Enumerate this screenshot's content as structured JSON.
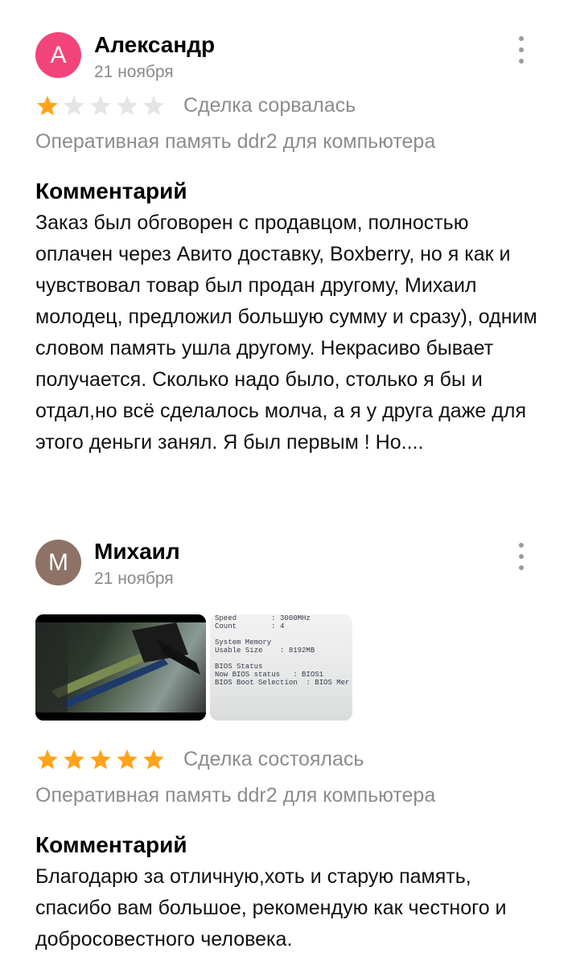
{
  "reviews": [
    {
      "avatar_letter": "А",
      "avatar_color": "#f2447b",
      "name": "Александр",
      "date": "21 ноября",
      "rating": 1,
      "deal_status": "Сделка сорвалась",
      "product": "Оперативная память ddr2 для компьютера",
      "comment_title": "Комментарий",
      "comment": "Заказ был обговорен с продавцом, полностью оплачен через Авито доставку, Boxberry, но я как и чувствовал товар был продан другому, Михаил молодец, предложил большую сумму и сразу), одним словом память ушла другому. Некрасиво бывает получается. Сколько надо было, столько я бы и отдал,но всё сделалось молча, а я у друга даже для этого деньги занял. Я был первым ! Но...."
    },
    {
      "avatar_letter": "М",
      "avatar_color": "#8e7266",
      "name": "Михаил",
      "date": "21 ноября",
      "rating": 5,
      "deal_status": "Сделка состоялась",
      "product": "Оперативная память ddr2 для компьютера",
      "comment_title": "Комментарий",
      "comment": "Благодарю за отличную,хоть и старую память, спасибо вам большое, рекомендую как честного и добросовестного человека.",
      "photos": [
        {
          "description": "photo-ram-in-motherboard"
        },
        {
          "bios_lines": [
            "Speed        : 3000MHz",
            "Count        : 4",
            "",
            "System Memory",
            "Usable Size    : 8192MB",
            "",
            "BIOS Status",
            "Now BIOS status   : BIOS1",
            "BIOS Boot Selection  : BIOS Mer"
          ]
        }
      ]
    }
  ],
  "colors": {
    "star_filled": "#ffa31a",
    "star_empty": "#e5e5e5"
  }
}
